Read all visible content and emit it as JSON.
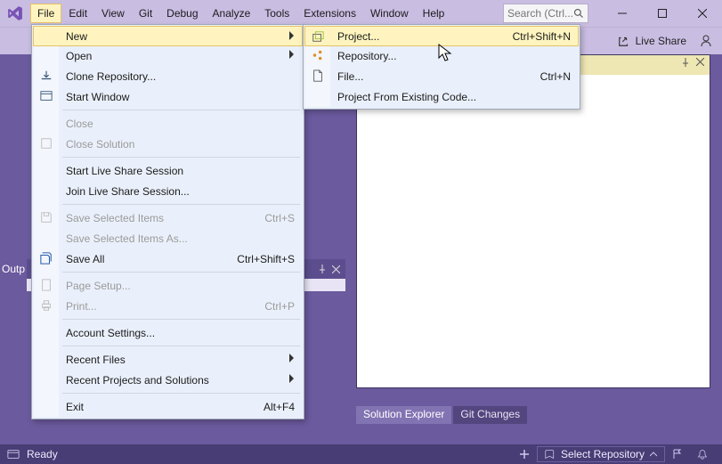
{
  "menubar": {
    "items": [
      "File",
      "Edit",
      "View",
      "Git",
      "Debug",
      "Analyze",
      "Tools",
      "Extensions",
      "Window",
      "Help"
    ],
    "open_index": 0
  },
  "search": {
    "placeholder": "Search (Ctrl..."
  },
  "toolbar": {
    "liveshare": "Live Share"
  },
  "file_menu": {
    "new": "New",
    "open": "Open",
    "clone": "Clone Repository...",
    "start_window": "Start Window",
    "close": "Close",
    "close_solution": "Close Solution",
    "start_ls": "Start Live Share Session",
    "join_ls": "Join Live Share Session...",
    "save_selected": "Save Selected Items",
    "save_selected_sc": "Ctrl+S",
    "save_selected_as": "Save Selected Items As...",
    "save_all": "Save All",
    "save_all_sc": "Ctrl+Shift+S",
    "page_setup": "Page Setup...",
    "print": "Print...",
    "print_sc": "Ctrl+P",
    "account": "Account Settings...",
    "recent_files": "Recent Files",
    "recent_projects": "Recent Projects and Solutions",
    "exit": "Exit",
    "exit_sc": "Alt+F4"
  },
  "new_submenu": {
    "project": "Project...",
    "project_sc": "Ctrl+Shift+N",
    "repository": "Repository...",
    "file": "File...",
    "file_sc": "Ctrl+N",
    "existing": "Project From Existing Code..."
  },
  "panels": {
    "output_label": "Outp",
    "solution_explorer": "Solution Explorer",
    "git_changes": "Git Changes"
  },
  "status": {
    "ready": "Ready",
    "select_repo": "Select Repository"
  }
}
